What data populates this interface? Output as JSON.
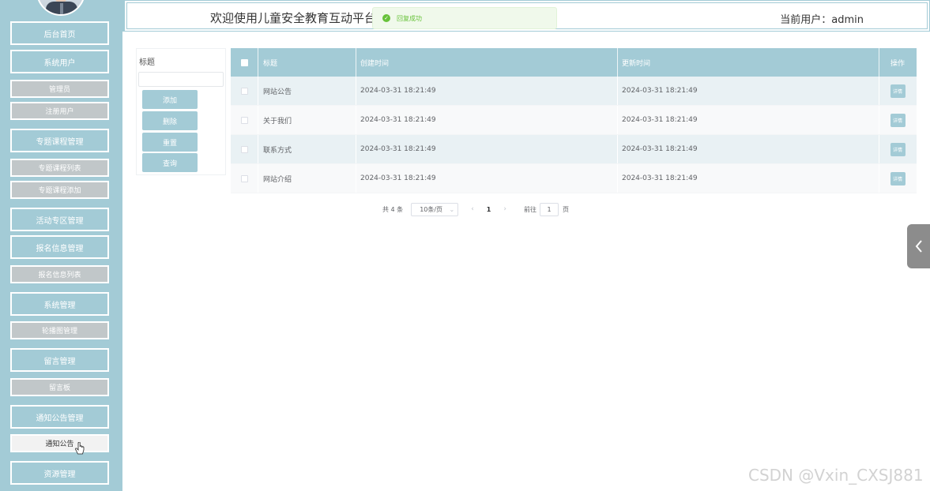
{
  "header": {
    "title": "欢迎使用儿童安全教育互动平台",
    "current_user": "当前用户：admin"
  },
  "toast": {
    "message": "回复成功",
    "icon": "check-circle-icon"
  },
  "sidebar": {
    "items": [
      {
        "label": "后台首页",
        "type": "main"
      },
      {
        "label": "系统用户",
        "type": "main"
      },
      {
        "label": "管理员",
        "type": "sub"
      },
      {
        "label": "注册用户",
        "type": "sub"
      },
      {
        "label": "专题课程管理",
        "type": "main"
      },
      {
        "label": "专题课程列表",
        "type": "sub"
      },
      {
        "label": "专题课程添加",
        "type": "sub"
      },
      {
        "label": "活动专区管理",
        "type": "main"
      },
      {
        "label": "报名信息管理",
        "type": "main"
      },
      {
        "label": "报名信息列表",
        "type": "sub"
      },
      {
        "label": "系统管理",
        "type": "main"
      },
      {
        "label": "轮播图管理",
        "type": "sub"
      },
      {
        "label": "留言管理",
        "type": "main"
      },
      {
        "label": "留言板",
        "type": "sub"
      },
      {
        "label": "通知公告管理",
        "type": "main"
      },
      {
        "label": "通知公告",
        "type": "sub",
        "active": true
      },
      {
        "label": "资源管理",
        "type": "main"
      }
    ]
  },
  "search_panel": {
    "label": "标题",
    "input_value": "",
    "buttons": [
      "添加",
      "删除",
      "重置",
      "查询"
    ]
  },
  "table": {
    "columns": [
      "标题",
      "创建时间",
      "更新时间",
      "操作"
    ],
    "rows": [
      {
        "title": "网站公告",
        "created": "2024-03-31 18:21:49",
        "updated": "2024-03-31 18:21:49",
        "action": "详情"
      },
      {
        "title": "关于我们",
        "created": "2024-03-31 18:21:49",
        "updated": "2024-03-31 18:21:49",
        "action": "详情"
      },
      {
        "title": "联系方式",
        "created": "2024-03-31 18:21:49",
        "updated": "2024-03-31 18:21:49",
        "action": "详情"
      },
      {
        "title": "网站介绍",
        "created": "2024-03-31 18:21:49",
        "updated": "2024-03-31 18:21:49",
        "action": "详情"
      }
    ]
  },
  "pagination": {
    "total": "共 4 条",
    "page_size": "10条/页",
    "prev": "‹",
    "current_page": "1",
    "next": "›",
    "goto_label": "前往",
    "goto_value": "1",
    "goto_unit": "页"
  },
  "watermark": "CSDN @Vxin_CXSJ881",
  "colors": {
    "accent": "#a3cbd6",
    "sub_menu": "#c1c7c9",
    "success": "#67c23a"
  }
}
